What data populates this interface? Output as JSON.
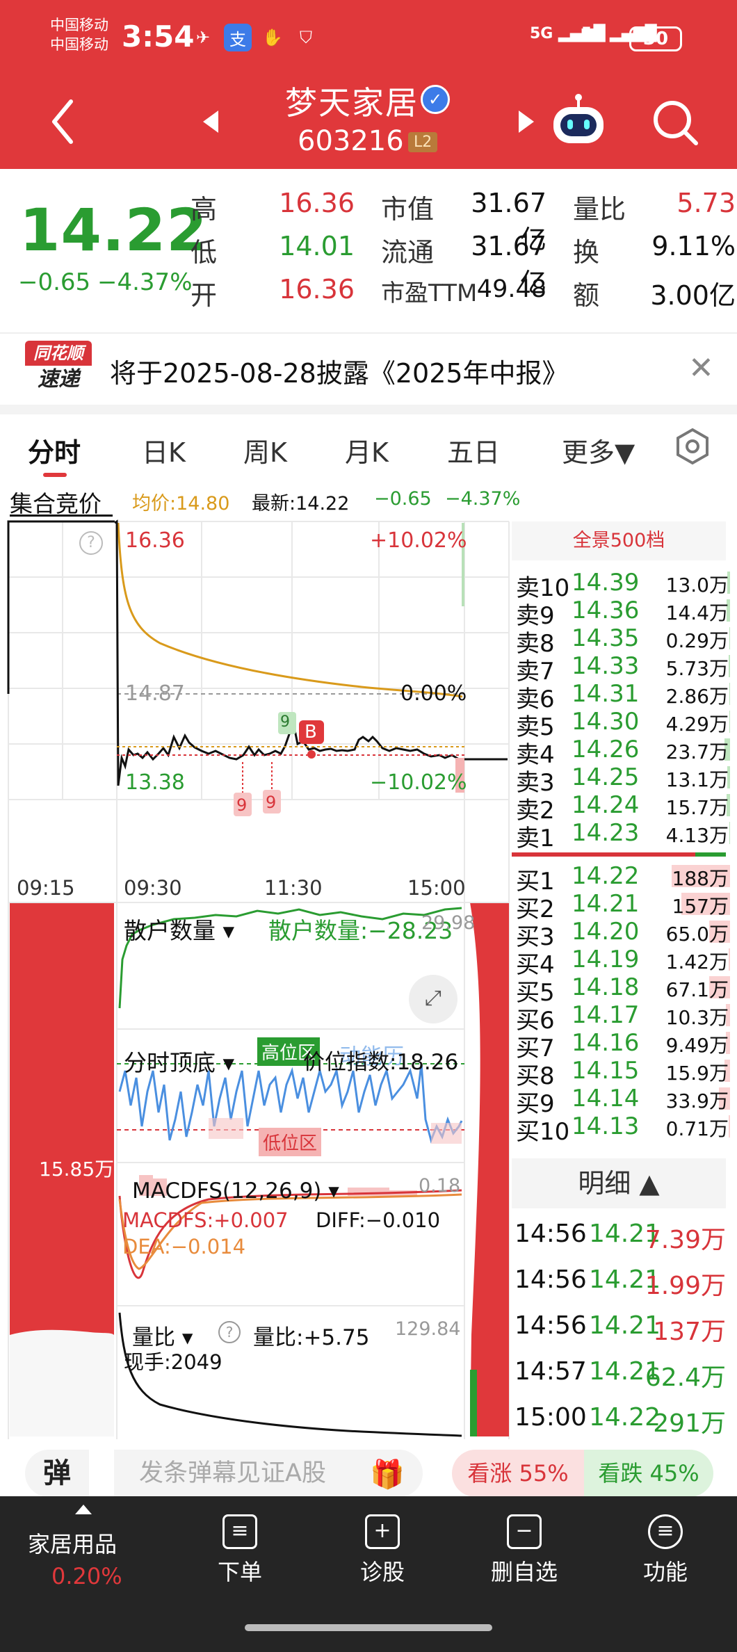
{
  "status_bar": {
    "carrier1": "中国移动",
    "carrier2": "中国移动",
    "time": "3:54",
    "signal1": "5G",
    "signal2": "5G",
    "battery": "30"
  },
  "header": {
    "stock_name": "梦天家居",
    "stock_code": "603216",
    "level_badge": "L2"
  },
  "quote": {
    "price": "14.22",
    "change": "−0.65",
    "change_pct": "−4.37%",
    "high_label": "高",
    "high": "16.36",
    "low_label": "低",
    "low": "14.01",
    "open_label": "开",
    "open": "16.36",
    "mktcap_label": "市值",
    "mktcap": "31.67亿",
    "float_label": "流通",
    "float": "31.67亿",
    "pe_label": "市盈TTM",
    "pe": "49.48",
    "volratio_label": "量比",
    "volratio": "5.73",
    "turnover_label": "换",
    "turnover": "9.11%",
    "amount_label": "额",
    "amount": "3.00亿"
  },
  "notice": {
    "logo_top": "同花顺",
    "logo_bottom": "速递",
    "text": "将于2025-08-28披露《2025年中报》"
  },
  "tabs": [
    "分时",
    "日K",
    "周K",
    "月K",
    "五日",
    "更多▼"
  ],
  "info_row": {
    "auction": "集合竞价",
    "avg": "均价:14.80",
    "latest": "最新:14.22",
    "chg": "−0.65",
    "pct": "−4.37%"
  },
  "chart": {
    "top_price": "16.36",
    "top_pct": "+10.02%",
    "mid_price": "14.87",
    "mid_pct": "0.00%",
    "bot_price": "13.38",
    "bot_pct": "−10.02%",
    "times": [
      "09:15",
      "09:30",
      "11:30",
      "15:00"
    ],
    "marker_b": "B",
    "marker_9": "9",
    "vol_label": "15.85万",
    "panel1_title": "散户数量",
    "panel1_value": "散户数量:−28.23",
    "panel1_top": "29.98",
    "panel2_title": "分时顶底",
    "panel2_high": "高位区",
    "panel2_low": "低位区",
    "panel2_value": "价位指数:18.26",
    "panel2_ghost": "动能历",
    "panel3_title": "MACDFS(12,26,9)",
    "panel3_top": "0.18",
    "panel3_macd": "MACDFS:+0.007",
    "panel3_diff": "DIFF:−0.010",
    "panel3_dea": "DEA:−0.014",
    "panel4_title": "量比",
    "panel4_value": "量比:+5.75",
    "panel4_top": "129.84",
    "panel4_now": "现手:2049"
  },
  "orderbook": {
    "header": "全景500档",
    "asks": [
      {
        "label": "卖10",
        "price": "14.39",
        "vol": "13.0万"
      },
      {
        "label": "卖9",
        "price": "14.36",
        "vol": "14.4万"
      },
      {
        "label": "卖8",
        "price": "14.35",
        "vol": "0.29万"
      },
      {
        "label": "卖7",
        "price": "14.33",
        "vol": "5.73万"
      },
      {
        "label": "卖6",
        "price": "14.31",
        "vol": "2.86万"
      },
      {
        "label": "卖5",
        "price": "14.30",
        "vol": "4.29万"
      },
      {
        "label": "卖4",
        "price": "14.26",
        "vol": "23.7万"
      },
      {
        "label": "卖3",
        "price": "14.25",
        "vol": "13.1万"
      },
      {
        "label": "卖2",
        "price": "14.24",
        "vol": "15.7万"
      },
      {
        "label": "卖1",
        "price": "14.23",
        "vol": "4.13万"
      }
    ],
    "bids": [
      {
        "label": "买1",
        "price": "14.22",
        "vol": "188万"
      },
      {
        "label": "买2",
        "price": "14.21",
        "vol": "157万"
      },
      {
        "label": "买3",
        "price": "14.20",
        "vol": "65.0万"
      },
      {
        "label": "买4",
        "price": "14.19",
        "vol": "1.42万"
      },
      {
        "label": "买5",
        "price": "14.18",
        "vol": "67.1万"
      },
      {
        "label": "买6",
        "price": "14.17",
        "vol": "10.3万"
      },
      {
        "label": "买7",
        "price": "14.16",
        "vol": "9.49万"
      },
      {
        "label": "买8",
        "price": "14.15",
        "vol": "15.9万"
      },
      {
        "label": "买9",
        "price": "14.14",
        "vol": "33.9万"
      },
      {
        "label": "买10",
        "price": "14.13",
        "vol": "0.71万"
      }
    ],
    "detail_header": "明细 ▲",
    "details": [
      {
        "time": "14:56",
        "price": "14.21",
        "vol": "7.39万"
      },
      {
        "time": "14:56",
        "price": "14.21",
        "vol": "1.99万"
      },
      {
        "time": "14:56",
        "price": "14.21",
        "vol": "137万"
      },
      {
        "time": "14:57",
        "price": "14.21",
        "vol": "62.4万"
      },
      {
        "time": "15:00",
        "price": "14.22",
        "vol": "291万"
      }
    ]
  },
  "danmu": {
    "btn": "弹",
    "placeholder": "发条弹幕见证A股",
    "rise": "看涨 55%",
    "fall": "看跌 45%"
  },
  "bottom_nav": {
    "sector": "家居用品",
    "sector_pct": "0.20%",
    "items": [
      "下单",
      "诊股",
      "删自选",
      "功能"
    ]
  }
}
